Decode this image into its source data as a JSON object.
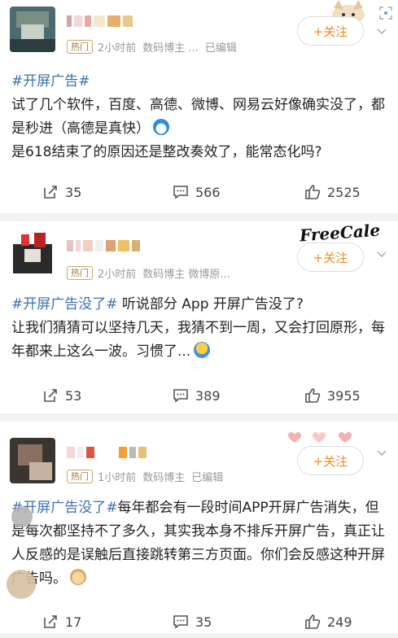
{
  "posts": [
    {
      "badge": "热门",
      "time": "2小时前",
      "source": "数码博主 ...",
      "edited": "已编辑",
      "follow_label": "+关注",
      "hashtag": "#开屏广告#",
      "text": "试了几个软件，百度、高德、微博、网易云好像确实没了，都是秒进（高德是真快）",
      "text2": "是618结束了的原因还是整改奏效了，能常态化吗?",
      "reposts": "35",
      "comments": "566",
      "likes": "2525"
    },
    {
      "badge": "热门",
      "time": "2小时前",
      "source": "数码博主 微博原...",
      "edited": "",
      "follow_label": "+关注",
      "hashtag": "#开屏广告没了#",
      "text": " 听说部分 App 开屏广告没了?",
      "text2": "让我们猜猜可以坚持几天，我猜不到一周，又会打回原形，每年都来上这么一波。习惯了...",
      "reposts": "53",
      "comments": "389",
      "likes": "3955",
      "sticker_text": "FreeCale"
    },
    {
      "badge": "热门",
      "time": "1小时前",
      "source": "数码博主",
      "edited": "已编辑",
      "follow_label": "+关注",
      "hashtag": "#开屏广告没了#",
      "text": "每年都会有一段时间APP开屏广告消失，但是每次都坚持不了多久，其实我本身不排斥开屏广告，真正让人反感的是误触后直接跳转第三方页面。你们会反感这种开屏广告吗。",
      "reposts": "17",
      "comments": "35",
      "likes": "249"
    }
  ],
  "colors": {
    "accent": "#f08a24",
    "hashtag": "#3c6fb3",
    "separator": "#f2f2f2"
  }
}
